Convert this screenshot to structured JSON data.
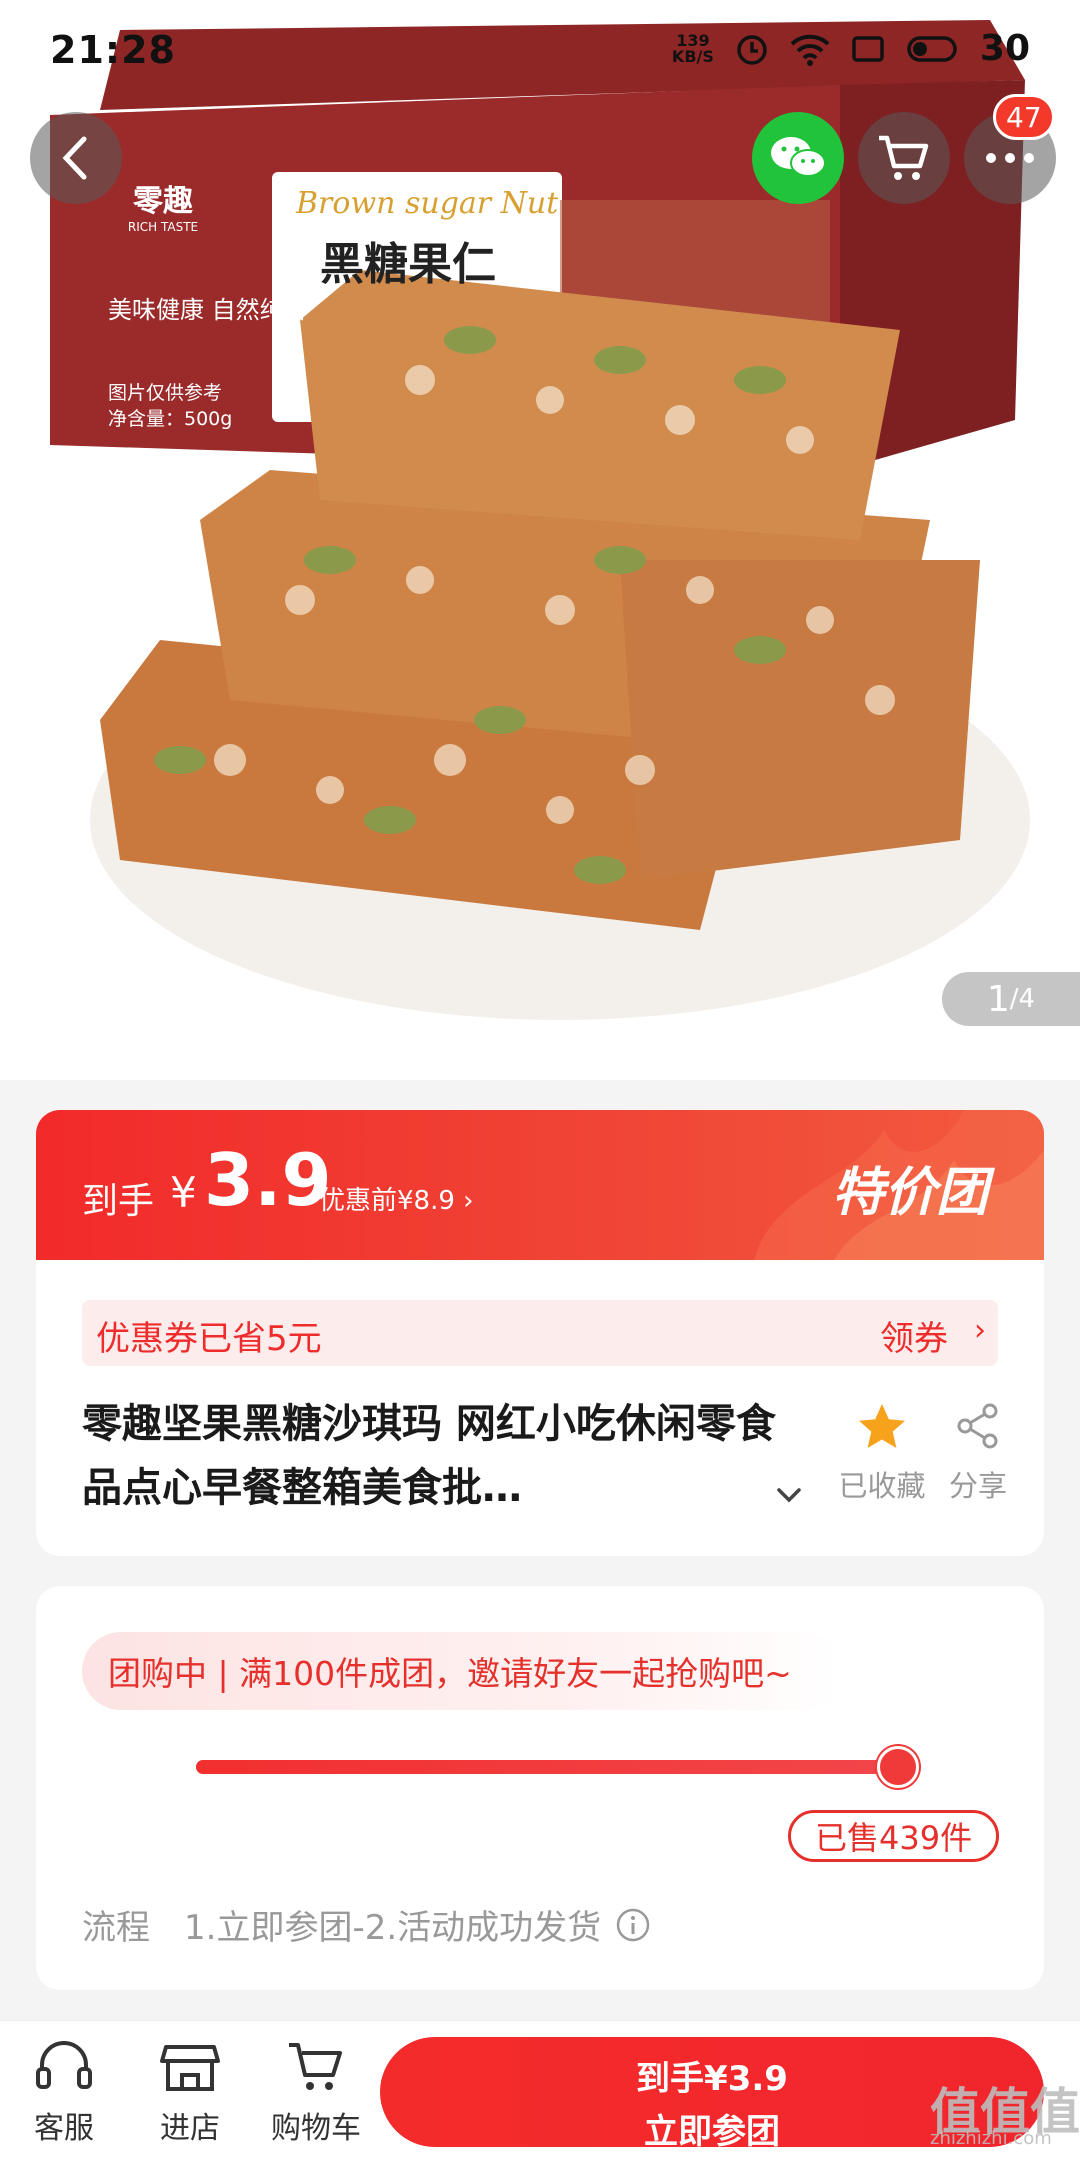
{
  "status_bar": {
    "time": "21:28",
    "net_speed_value": "139",
    "net_speed_unit": "KB/S",
    "battery": "30"
  },
  "nav": {
    "cart_badge": "47"
  },
  "hero": {
    "box_brand_en": "RICH TASTE",
    "box_brand_cn": "零趣",
    "box_title_en": "Brown sugar Nut",
    "box_title_cn": "黑糖果仁",
    "box_slogan": "美味健康 自然纯香",
    "box_note": "图片仅供参考",
    "box_weight": "净含量：500g",
    "pager_current": "1",
    "pager_total": "/4"
  },
  "price": {
    "label": "到手",
    "yen": "¥",
    "amount": "3.9",
    "before": "优惠前¥8.9",
    "special_tag": "特价团"
  },
  "coupon": {
    "saved": "优惠券已省5元",
    "get": "领券"
  },
  "product": {
    "title": "零趣坚果黑糖沙琪玛  网红小吃休闲零食品点心早餐整箱美食批…",
    "fav_label": "已收藏",
    "share_label": "分享"
  },
  "group": {
    "status": "团购中 | 满100件成团，邀请好友一起抢购吧~",
    "progress": 1.0,
    "sold": "已售439件",
    "flow_key": "流程",
    "flow_value": "1.立即参团-2.活动成功发货"
  },
  "bottom": {
    "tabs": [
      {
        "label": "客服",
        "icon": "headset-icon"
      },
      {
        "label": "进店",
        "icon": "store-icon"
      },
      {
        "label": "购物车",
        "icon": "cart-icon"
      }
    ],
    "buy_price": "到手¥3.9",
    "buy_label": "立即参团"
  },
  "watermark": {
    "text": "值值值",
    "domain": "zhizhizhi.com"
  },
  "colors": {
    "accent_red": "#f22a2a",
    "wechat_green": "#21c33b",
    "star_orange": "#f7a21b"
  }
}
